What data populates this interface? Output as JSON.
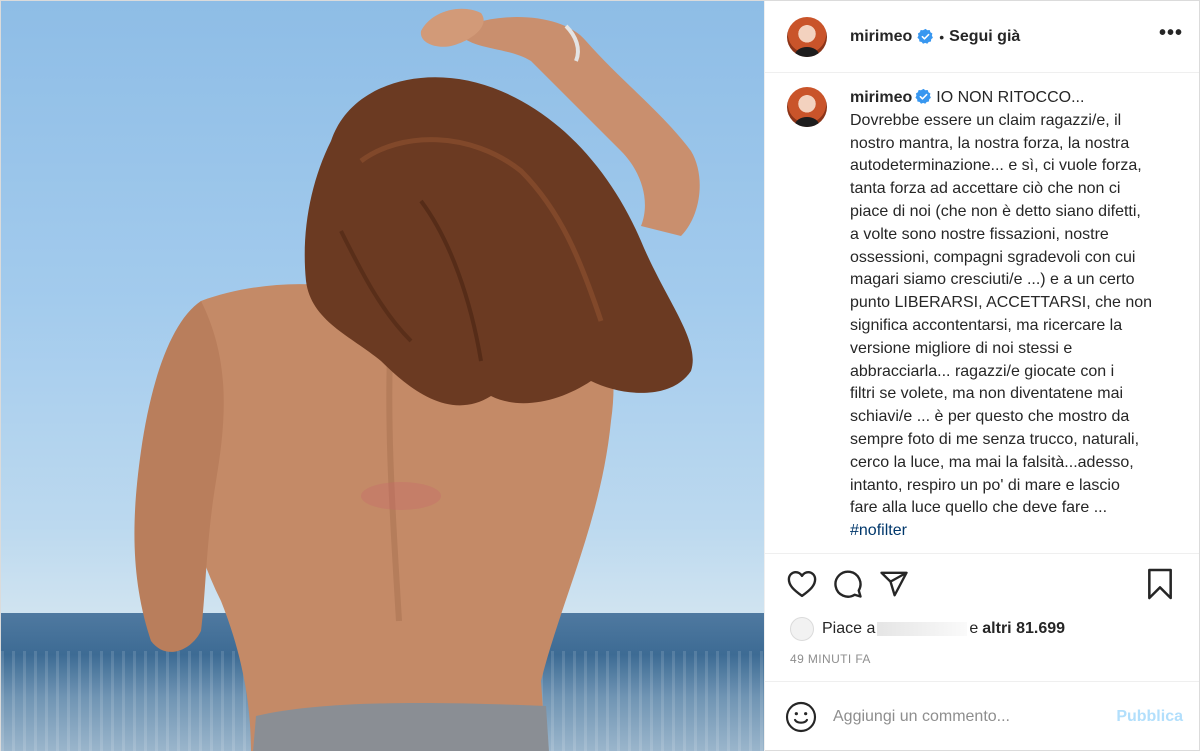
{
  "header": {
    "username": "mirimeo",
    "separator": "•",
    "follow_label": "Segui già",
    "more_label": "•••"
  },
  "caption": {
    "username": "mirimeo",
    "lines": [
      "IO NON RITOCCO...",
      "Dovrebbe essere un claim ragazzi/e, il",
      "nostro mantra, la nostra forza, la nostra",
      "autodeterminazione... e sì, ci vuole forza,",
      "tanta forza ad accettare ciò che non ci",
      "piace di noi (che non è detto siano difetti,",
      "a volte sono nostre fissazioni, nostre",
      "ossessioni, compagni sgradevoli con cui",
      "magari siamo cresciuti/e ...) e a un certo",
      "punto LIBERARSI, ACCETTARSI, che non",
      "significa accontentarsi, ma ricercare la",
      "versione migliore di noi stessi e",
      "abbracciarla... ragazzi/e giocate con i",
      "filtri se volete, ma non diventatene mai",
      "schiavi/e ... è per questo che mostro da",
      "sempre foto di me senza trucco, naturali,",
      "cerco la luce, ma mai la falsità...adesso,",
      "intanto, respiro un po' di mare e lascio",
      "fare alla luce quello che deve fare ..."
    ],
    "hashtag": "#nofilter"
  },
  "actions": {
    "like_icon": "heart-icon",
    "comment_icon": "comment-bubble-icon",
    "share_icon": "paper-plane-icon",
    "save_icon": "bookmark-icon"
  },
  "likes": {
    "prefix": "Piace a",
    "conjunction": "e",
    "others": "altri 81.699"
  },
  "timestamp": "49 MINUTI FA",
  "composer": {
    "placeholder": "Aggiungi un commento...",
    "publish_label": "Pubblica"
  },
  "colors": {
    "verified": "#3897f0",
    "hashtag": "#00376b",
    "publish_disabled": "#b2dffc",
    "muted": "#8e8e8e"
  }
}
